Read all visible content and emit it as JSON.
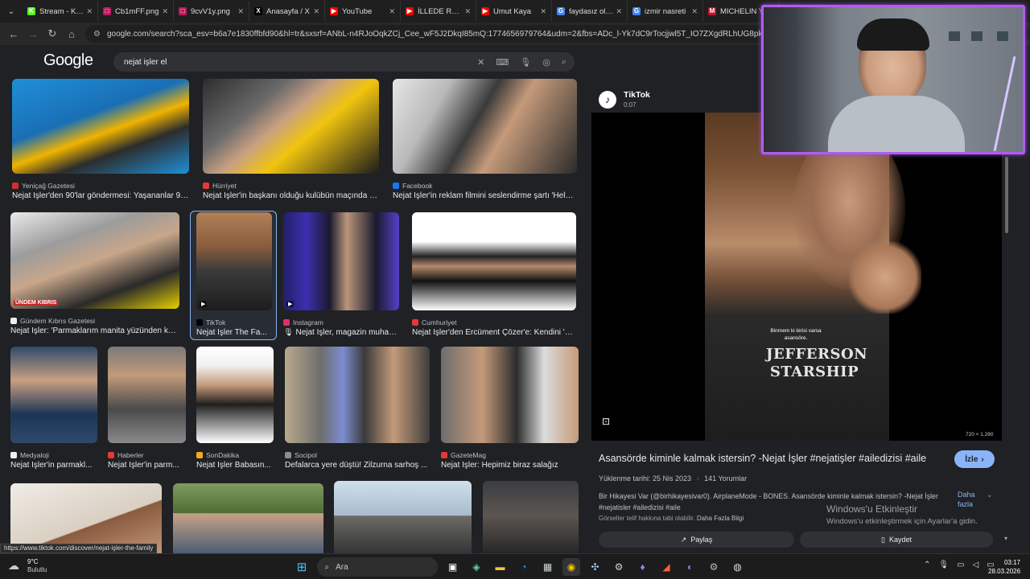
{
  "browser": {
    "tabs": [
      {
        "label": "Stream - Kick",
        "color": "#53fc18",
        "glyph": "K"
      },
      {
        "label": "Cb1mFF.png",
        "color": "#c2185b",
        "glyph": "□"
      },
      {
        "label": "9cvV1y.png",
        "color": "#c2185b",
        "glyph": "□"
      },
      {
        "label": "Anasayfa / X",
        "color": "#000000",
        "glyph": "X"
      },
      {
        "label": "YouTube",
        "color": "#ff0000",
        "glyph": "▶"
      },
      {
        "label": "İLLEDE ROM",
        "color": "#ff0000",
        "glyph": "▶"
      },
      {
        "label": "Umut Kaya",
        "color": "#ff0000",
        "glyph": "▶"
      },
      {
        "label": "faydasız olan",
        "color": "#4285f4",
        "glyph": "G"
      },
      {
        "label": "izmir nasreti",
        "color": "#4285f4",
        "glyph": "G"
      },
      {
        "label": "MICHELIN Y",
        "color": "#c8102e",
        "glyph": "M"
      }
    ],
    "url": "google.com/search?sca_esv=b6a7e1830ffbfd90&hl=tr&sxsrf=ANbL-n4RJoOqkZCj_Cee_wF5J2DkqI85mQ:1774656979764&udm=2&fbs=ADc_l-Yk7dC9rTocjjwl5T_IO7ZXgdRLhUG8pk-pM063RkPlLQoV"
  },
  "google": {
    "logo": "Google",
    "query": "nejat işler el"
  },
  "results": [
    {
      "source": "Yeniçağ Gazetesi",
      "title": "Nejat İşler'den 90'lar göndermesi: Yaşananlar 90...",
      "src_color": "#d32f2f"
    },
    {
      "source": "Hürriyet",
      "title": "Nejat İşler'in başkanı olduğu kulübün maçında ol...",
      "src_color": "#e53935"
    },
    {
      "source": "Facebook",
      "title": "Nejat İşler'in reklam filmini seslendirme şartı 'Helal ...",
      "src_color": "#1877f2"
    },
    {
      "source": "Gündem Kıbrıs Gazetesi",
      "title": "Nejat İşler: 'Parmaklarım manita yüzünden kes...",
      "src_color": "#eeeeee",
      "overlay": "ÜNDEM KIBRIS"
    },
    {
      "source": "TikTok",
      "title": "Nejat İşler The Fa...",
      "src_color": "#000000",
      "overlay": "▶"
    },
    {
      "source": "Instagram",
      "title": "🎙 Nejat İşler, magazin muhab...",
      "src_color": "#e1306c",
      "overlay": "▶"
    },
    {
      "source": "Cumhuriyet",
      "title": "Nejat İşler'den Ercüment Çözer'e: Kendini 'üs...",
      "src_color": "#e53935"
    },
    {
      "source": "Medyaloji",
      "title": "Nejat İşler'in parmakl...",
      "src_color": "#eeeeee"
    },
    {
      "source": "Haberler",
      "title": "Nejat İşler'in parm...",
      "src_color": "#e53935"
    },
    {
      "source": "SonDakika",
      "title": "Nejat İşler Babasın...",
      "src_color": "#f9a825"
    },
    {
      "source": "Socipol",
      "title": "Defalarca yere düştü! Zilzurna sarhoş ...",
      "src_color": "#8d8d8d"
    },
    {
      "source": "GazeteMag",
      "title": "Nejat İşler: Hepimiz biraz salağız",
      "src_color": "#e53935"
    }
  ],
  "panel": {
    "platform": "TikTok",
    "duration": "0:07",
    "caption": "Binmem ki birisi varsa asansöre.",
    "shirt_text": "JEFFERSON STARSHIP",
    "resolution": "720 × 1.280",
    "title": "Asansörde kiminle kalmak istersin? -Nejat İşler #nejatişler #ailedizisi #aile",
    "watch_label": "İzle",
    "upload_date": "Yüklenme tarihi: 25 Nis 2023",
    "comments": "141 Yorumlar",
    "description": "Bir Hikayesi Var (@birhikayesivar0). AirplaneMode - BONES. Asansörde kiminle kalmak istersin? -Nejat İşler #nejatisler #ailedizisi #aile",
    "more_label": "Daha fazla",
    "copyright": "Görseller telif hakkına tabi olabilir.",
    "more_info": "Daha Fazla Bilgi",
    "share_label": "Paylaş",
    "save_label": "Kaydet"
  },
  "watermark": {
    "line1": "Windows'u Etkinleştir",
    "line2": "Windows'u etkinleştirmek için Ayarlar'a gidin."
  },
  "status_url": "https://www.tiktok.com/discover/nejat-işler-the-family",
  "taskbar": {
    "temperature": "9°C",
    "weather": "Bulutlu",
    "search_placeholder": "Ara",
    "time": "03:17",
    "date": "28.03.2026"
  }
}
